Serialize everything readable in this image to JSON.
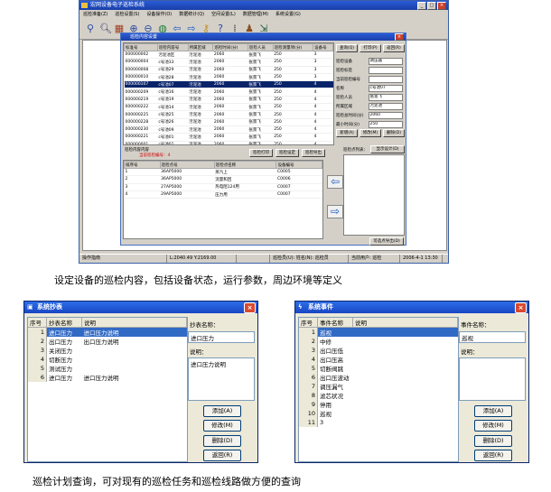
{
  "app": {
    "title": "宏网设备电子巡检系统",
    "menu": [
      "巡检准备(Z)",
      "巡检设置(S)",
      "设备操作(O)",
      "数据统计(Q)",
      "空间设置(L)",
      "数据管理(M)",
      "系统设置(G)"
    ],
    "status": [
      "操作指南",
      "L:2040.49 Y:2169.00",
      "",
      "巡检员(U): 姓名(N): 巡检员",
      "当前用户: 巡检",
      "2006-4-1 13:30"
    ]
  },
  "dialog": {
    "title": "巡检内容设置",
    "grid": {
      "columns": [
        "标准号",
        "巡检内容号",
        "所属区域",
        "巡检时间(分)",
        "巡检人员",
        "巡检测量项(分)",
        "设备号"
      ],
      "rows": [
        [
          "000000002",
          "污泥池区",
          "污泥池",
          "2060",
          "张景飞",
          "250",
          "3"
        ],
        [
          "000000004",
          "c号池33",
          "污泥池",
          "2060",
          "张景飞",
          "250",
          "3"
        ],
        [
          "000000008",
          "c号池29",
          "污泥池",
          "2060",
          "张景飞",
          "250",
          "3"
        ],
        [
          "000000010",
          "c号池28",
          "污泥池",
          "2060",
          "张景飞",
          "250",
          "3"
        ],
        [
          "000000107",
          "c号池07",
          "污泥池",
          "2060",
          "张景飞",
          "250",
          "4"
        ],
        [
          "000000209",
          "c号池16",
          "污泥池",
          "2060",
          "张景飞",
          "250",
          "4"
        ],
        [
          "000000219",
          "c号池19",
          "污泥池",
          "2060",
          "张景飞",
          "250",
          "4"
        ],
        [
          "000000222",
          "c号池14",
          "污泥池",
          "2060",
          "张景飞",
          "250",
          "4"
        ],
        [
          "000000225",
          "c号池25",
          "污泥池",
          "2060",
          "张景飞",
          "250",
          "4"
        ],
        [
          "000000228",
          "c号池26",
          "污泥池",
          "2060",
          "张景飞",
          "250",
          "4"
        ],
        [
          "000000230",
          "c号池09",
          "污泥池",
          "2060",
          "张景飞",
          "250",
          "4"
        ],
        [
          "000000221",
          "c号池01",
          "污泥池",
          "2060",
          "张景飞",
          "250",
          "4"
        ],
        [
          "000000001",
          "c号池01",
          "污泥池",
          "2060",
          "张景飞",
          "250",
          "4"
        ]
      ],
      "selected": 4
    },
    "right_buttons": [
      "查询(Q)",
      "打印(P)",
      "返回(R)"
    ],
    "right_fields": [
      {
        "label": "巡检设备",
        "value": "调压器"
      },
      {
        "label": "巡检标签",
        "value": ""
      },
      {
        "label": "当前巡检编号",
        "value": ""
      },
      {
        "label": "名称",
        "value": "c号池07"
      },
      {
        "label": "巡检人员",
        "value": "张景飞"
      },
      {
        "label": "所属区域",
        "value": "污泥池"
      },
      {
        "label": "巡检总时间(分)",
        "value": "2060"
      },
      {
        "label": "最小时间(分)",
        "value": "250"
      }
    ],
    "action_buttons": [
      "新增(A)",
      "修改(M)",
      "删除(D)"
    ],
    "sub_header": "巡检内容内容",
    "sub_count": "当前巡检编号：4",
    "sub_buttons": [
      "巡检打印",
      "巡检设定",
      "巡检导出"
    ],
    "sub_grid": {
      "columns": [
        "排序号",
        "巡检点号",
        "巡检点名称",
        "设备编号"
      ],
      "rows": [
        [
          "1",
          "36AP5000",
          "蒸汽上",
          "C0005"
        ],
        [
          "2",
          "36AP5000",
          "流量和回",
          "C0006"
        ],
        [
          "3",
          "27AP5000",
          "热电阻124用",
          "C0007"
        ],
        [
          "4",
          "29AP5000",
          "压力用",
          "C0007"
        ]
      ]
    },
    "right_panel_label": "巡检点列表：",
    "right_panel_btn": "显示设计(D)",
    "bottom_btn": "可选点导出(D)"
  },
  "caption1": "设定设备的巡检内容，包括设备状态，运行参数，周边环境等定义",
  "caption2": "巡检计划查询，可对现有的巡检任务和巡检线路做方便的查询",
  "win_left": {
    "title": "系统抄表",
    "columns": [
      "序号",
      "抄表名称",
      "说明"
    ],
    "rows": [
      [
        "1",
        "进口压力",
        "进口压力说明"
      ],
      [
        "2",
        "出口压力",
        "出口压力说明"
      ],
      [
        "3",
        "关闭压力",
        ""
      ],
      [
        "4",
        "切断压力",
        ""
      ],
      [
        "5",
        "测试压力",
        ""
      ],
      [
        "6",
        "进口压力",
        "进口压力说明"
      ]
    ],
    "selected": 0,
    "name_label": "抄表名称：",
    "name_value": "进口压力",
    "desc_label": "说明：",
    "desc_value": "进口压力说明",
    "buttons": [
      "添加(A)",
      "修改(M)",
      "删除(D)",
      "返回(R)"
    ]
  },
  "win_right": {
    "title": "系统事件",
    "columns": [
      "序号",
      "事件名称",
      "说明"
    ],
    "rows": [
      [
        "1",
        "巡视",
        ""
      ],
      [
        "2",
        "中修",
        ""
      ],
      [
        "3",
        "出口压低",
        ""
      ],
      [
        "4",
        "出口压高",
        ""
      ],
      [
        "5",
        "切断阀跳",
        ""
      ],
      [
        "6",
        "出口压波动",
        ""
      ],
      [
        "7",
        "调压漏气",
        ""
      ],
      [
        "8",
        "滤芯状况",
        ""
      ],
      [
        "9",
        "停用",
        ""
      ],
      [
        "10",
        "巡视",
        ""
      ],
      [
        "11",
        "3",
        ""
      ]
    ],
    "selected": 0,
    "name_label": "事件名称：",
    "name_value": "巡视",
    "desc_label": "说明：",
    "desc_value": "",
    "buttons": [
      "添加(A)",
      "修改(M)",
      "删除(D)",
      "返回(R)"
    ]
  },
  "icons": [
    "lens-icon",
    "search-icon",
    "book-icon",
    "zoom-in-icon",
    "zoom-out-icon",
    "globe-icon",
    "arrow-left-icon",
    "arrow-right-icon",
    "key-icon",
    "help-icon",
    "info-icon",
    "people-icon",
    "export-icon"
  ]
}
